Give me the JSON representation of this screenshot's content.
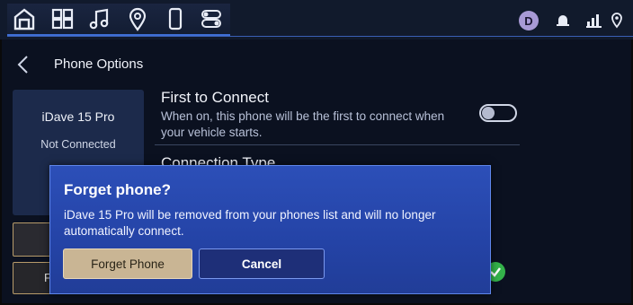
{
  "topbar": {
    "nav_icons": [
      "home-icon",
      "apps-grid-icon",
      "music-note-icon",
      "map-pin-icon",
      "phone-icon",
      "settings-toggles-icon"
    ],
    "avatar_letter": "D",
    "status_icons": [
      "notification-bell-icon",
      "cell-signal-icon",
      "location-icon"
    ]
  },
  "header": {
    "title": "Phone Options"
  },
  "phone_card": {
    "name": "iDave 15 Pro",
    "status": "Not Connected"
  },
  "settings": {
    "first_to_connect": {
      "title": "First to Connect",
      "description": "When on, this phone will be the first to connect when your vehicle starts.",
      "toggle_state": "off"
    },
    "connection_type": {
      "title": "Connection Type"
    }
  },
  "left_buttons": {
    "partial_label": "F"
  },
  "dialog": {
    "title": "Forget phone?",
    "message": "iDave 15 Pro will be removed from your phones list and will no longer automatically connect.",
    "forget_label": "Forget Phone",
    "cancel_label": "Cancel"
  },
  "colors": {
    "accent": "#3f6fd6",
    "dialog": "#2443a6",
    "forget_button": "#c9b594",
    "check": "#34b24a"
  }
}
